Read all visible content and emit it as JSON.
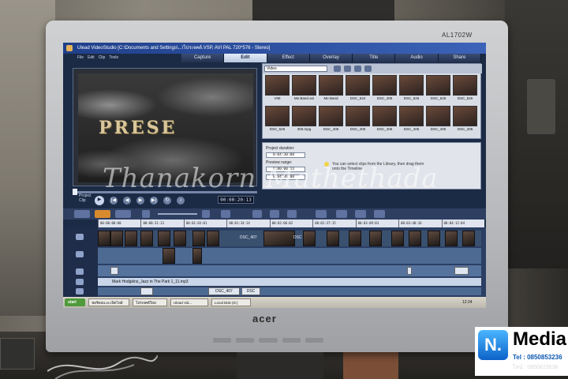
{
  "monitor": {
    "model": "AL1702W",
    "brand": "acer"
  },
  "app": {
    "title": "Ulead VideoStudio [C:\\Documents and Settings\\...\\โปรเจคต์.VSP, AVI PAL 720*576 - Stereo]",
    "menu": [
      "File",
      "Edit",
      "Clip",
      "Tools"
    ],
    "steps": [
      "Capture",
      "Edit",
      "Effect",
      "Overlay",
      "Title",
      "Audio",
      "Share"
    ],
    "active_step": "Edit"
  },
  "preview": {
    "text": "PRESE",
    "timecode": "00:00:20:13",
    "mode_label": "Project Clip"
  },
  "library": {
    "category": "Video",
    "clips": [
      "V08",
      "Me Band ani",
      "Me Band",
      "DSC_534",
      "DSC_405",
      "DSC_526",
      "DSC_526",
      "DSC_526",
      "DSC_526",
      "300.mpg",
      "DSC_405",
      "DSC_405",
      "DSC_405",
      "DSC_405",
      "DSC_405",
      "DSC_405"
    ]
  },
  "options": {
    "duration_label": "Project duration:",
    "duration": "0:04:30:00",
    "range_label": "Preview range:",
    "range_start": "0:00:00:00",
    "range_end": "0:04:30:00",
    "hint": "You can select clips from the Library, then drag them onto the Timeline."
  },
  "ruler": [
    "00:00:00:00",
    "00:00:31:13",
    "00:01:03:01",
    "00:01:34:14",
    "00:02:06:02",
    "00:02:37:15",
    "00:03:09:03",
    "00:03:40:16",
    "00:04:12:04"
  ],
  "timeline": {
    "video_labels": [
      "DSC_407",
      "DSC"
    ],
    "audio_clip": "Mark Hodgkins_Jazz in The Park 1_11.mp3",
    "music_clips": [
      "DSC_407",
      "DSC"
    ]
  },
  "taskbar": {
    "start": "start",
    "tasks": [
      "ฟอร์ตอน.vs.เปิดไฟล์",
      "โปรเจคต์ใหม่",
      "Ulead Vid...",
      "Local Disk (D:)"
    ],
    "clock": "12:24"
  },
  "watermark": "Thanakorn Mathethada",
  "logo": {
    "mark": "N.",
    "name": "Media",
    "tel": "Tel : 0850853236",
    "line": "ไลน์ : 0850823536"
  }
}
